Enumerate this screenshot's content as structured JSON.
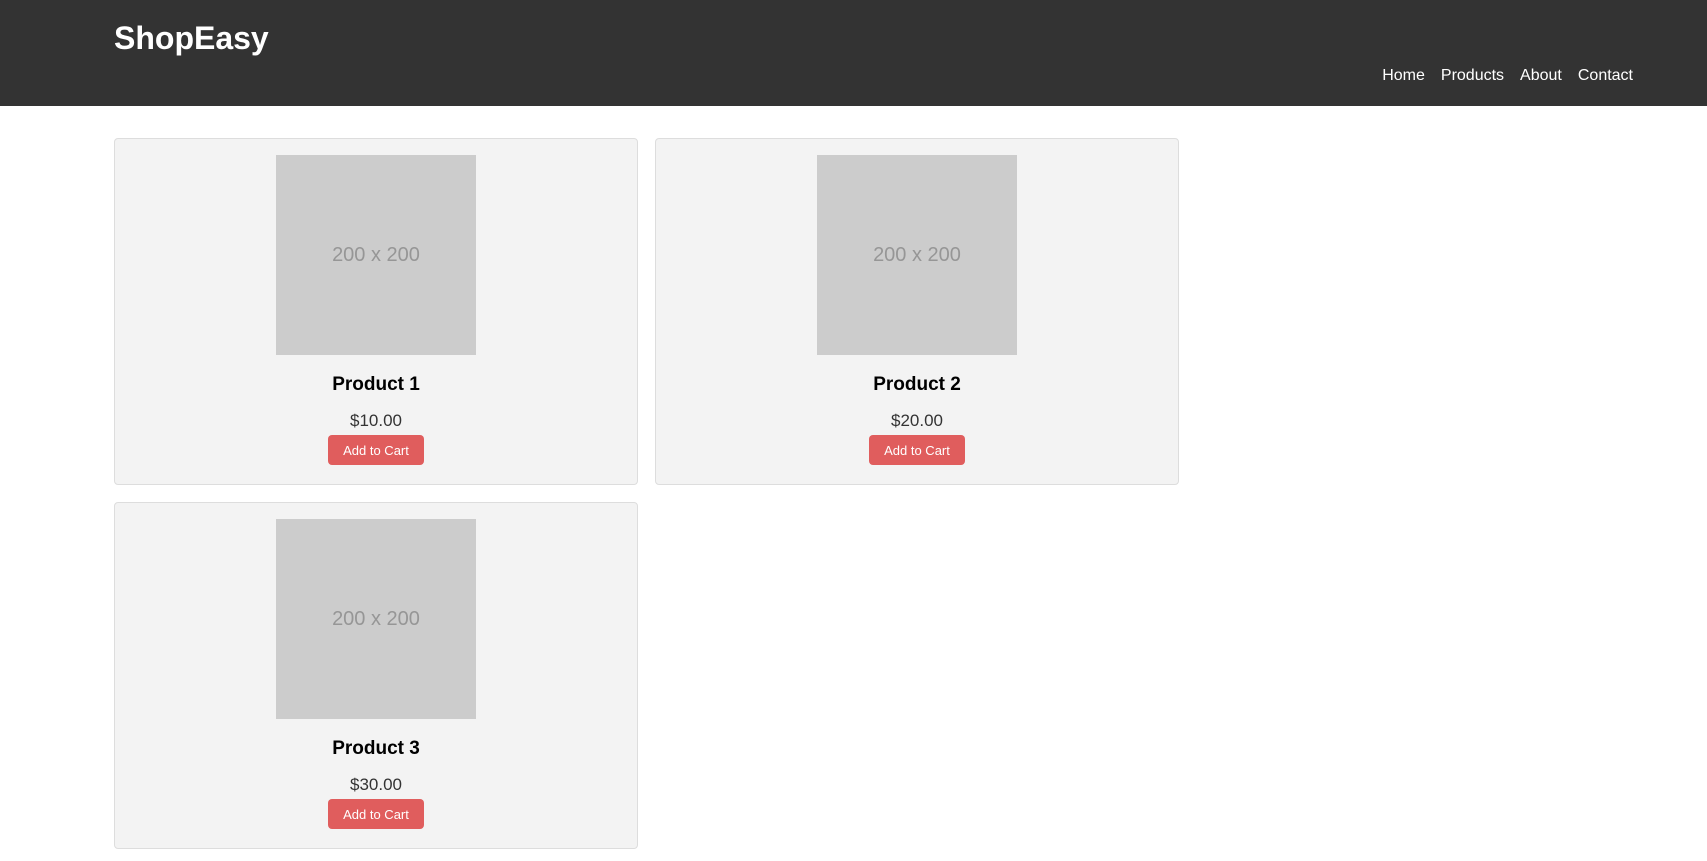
{
  "header": {
    "brand": "ShopEasy",
    "nav": [
      {
        "label": "Home"
      },
      {
        "label": "Products"
      },
      {
        "label": "About"
      },
      {
        "label": "Contact"
      }
    ]
  },
  "products": [
    {
      "image_placeholder": "200 x 200",
      "name": "Product 1",
      "price": "$10.00",
      "button_label": "Add to Cart"
    },
    {
      "image_placeholder": "200 x 200",
      "name": "Product 2",
      "price": "$20.00",
      "button_label": "Add to Cart"
    },
    {
      "image_placeholder": "200 x 200",
      "name": "Product 3",
      "price": "$30.00",
      "button_label": "Add to Cart"
    }
  ],
  "colors": {
    "header_bg": "#333333",
    "card_bg": "#f3f3f3",
    "button_bg": "#e05d5d",
    "placeholder_bg": "#cccccc"
  }
}
